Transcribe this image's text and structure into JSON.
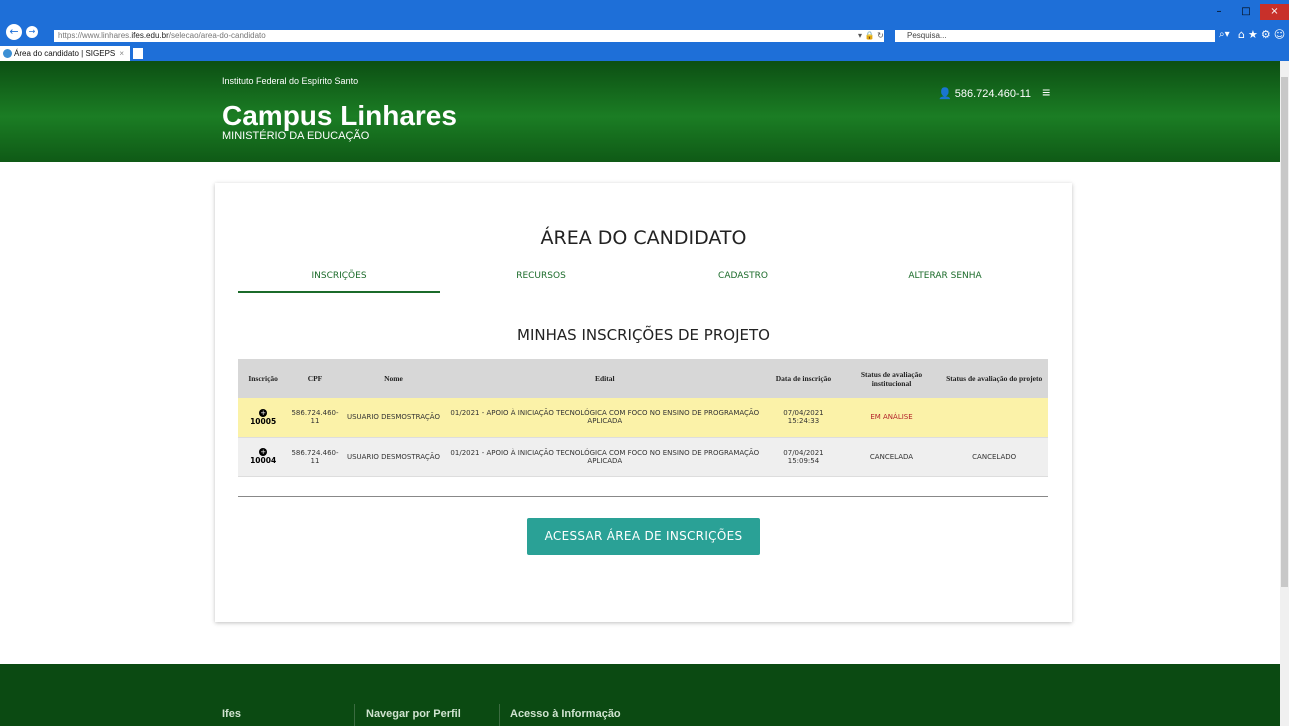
{
  "browser": {
    "url_prefix": "https://www.linhares.",
    "url_domain": "ifes.edu.br",
    "url_path": "/selecao/area-do-candidato",
    "search_placeholder": "Pesquisa...",
    "tab_title": "Área do candidato | SIGEPS",
    "tab_close": "×",
    "window_buttons": [
      "–",
      "□",
      "×"
    ]
  },
  "header": {
    "institution": "Instituto Federal do Espírito Santo",
    "campus": "Campus Linhares",
    "ministry": "MINISTÉRIO DA EDUCAÇÃO",
    "user_id": "586.724.460-11"
  },
  "page": {
    "title": "ÁREA DO CANDIDATO",
    "tabs": [
      {
        "label": "INSCRIÇÕES",
        "active": true
      },
      {
        "label": "RECURSOS",
        "active": false
      },
      {
        "label": "CADASTRO",
        "active": false
      },
      {
        "label": "ALTERAR SENHA",
        "active": false
      }
    ],
    "section_title": "MINHAS INSCRIÇÕES DE PROJETO",
    "table": {
      "headers": [
        "Inscrição",
        "CPF",
        "Nome",
        "Edital",
        "Data de inscrição",
        "Status de avaliação institucional",
        "Status de avaliação do projeto"
      ],
      "rows": [
        {
          "inscricao": "10005",
          "cpf": "586.724.460-11",
          "nome": "USUARIO DESMOSTRAÇÃO",
          "edital": "01/2021 - APOIO À INICIAÇÃO TECNOLÓGICA COM FOCO NO ENSINO DE PROGRAMAÇÃO APLICADA",
          "data": "07/04/2021 15:24:33",
          "status_inst": "EM ANÁLISE",
          "status_proj": ""
        },
        {
          "inscricao": "10004",
          "cpf": "586.724.460-11",
          "nome": "USUARIO DESMOSTRAÇÃO",
          "edital": "01/2021 - APOIO À INICIAÇÃO TECNOLÓGICA COM FOCO NO ENSINO DE PROGRAMAÇÃO APLICADA",
          "data": "07/04/2021 15:09:54",
          "status_inst": "CANCELADA",
          "status_proj": "CANCELADO"
        }
      ]
    },
    "cta_label": "ACESSAR ÁREA DE INSCRIÇÕES"
  },
  "footer": {
    "links": [
      "Ifes",
      "Navegar por Perfil",
      "Acesso à Informação"
    ]
  },
  "colors": {
    "header_green": "#1b7d24",
    "footer_green": "#0b4a12",
    "tab_green": "#1b6b2a",
    "cta_teal": "#2aa196",
    "highlight_row": "#fbf2a8",
    "status_red": "#b3242a"
  }
}
